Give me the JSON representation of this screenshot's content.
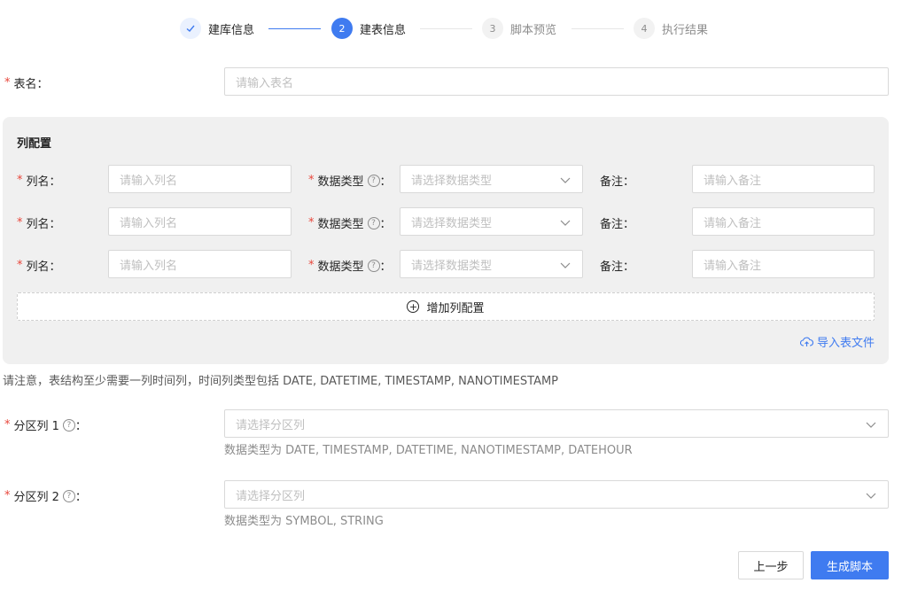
{
  "steps": [
    {
      "index": "1",
      "label": "建库信息",
      "state": "done"
    },
    {
      "index": "2",
      "label": "建表信息",
      "state": "active"
    },
    {
      "index": "3",
      "label": "脚本预览",
      "state": "wait"
    },
    {
      "index": "4",
      "label": "执行结果",
      "state": "wait"
    }
  ],
  "table_name": {
    "label": "表名：",
    "placeholder": "请输入表名"
  },
  "column_config": {
    "title": "列配置",
    "rows": [
      {
        "name_label": "列名：",
        "name_placeholder": "请输入列名",
        "type_label": "数据类型",
        "type_placeholder": "请选择数据类型",
        "remark_label": "备注：",
        "remark_placeholder": "请输入备注"
      },
      {
        "name_label": "列名：",
        "name_placeholder": "请输入列名",
        "type_label": "数据类型",
        "type_placeholder": "请选择数据类型",
        "remark_label": "备注：",
        "remark_placeholder": "请输入备注"
      },
      {
        "name_label": "列名：",
        "name_placeholder": "请输入列名",
        "type_label": "数据类型",
        "type_placeholder": "请选择数据类型",
        "remark_label": "备注：",
        "remark_placeholder": "请输入备注"
      }
    ],
    "add_label": "增加列配置",
    "import_label": "导入表文件"
  },
  "note": "请注意，表结构至少需要一列时间列，时间列类型包括 DATE, DATETIME, TIMESTAMP, NANOTIMESTAMP",
  "partition1": {
    "label": "分区列 1",
    "placeholder": "请选择分区列",
    "hint": "数据类型为 DATE, TIMESTAMP, DATETIME, NANOTIMESTAMP, DATEHOUR"
  },
  "partition2": {
    "label": "分区列 2",
    "placeholder": "请选择分区列",
    "hint": "数据类型为 SYMBOL, STRING"
  },
  "buttons": {
    "prev": "上一步",
    "generate": "生成脚本"
  },
  "colors": {
    "primary": "#3f7bf0",
    "required": "#e8463b",
    "panel": "#f0f0f0"
  }
}
